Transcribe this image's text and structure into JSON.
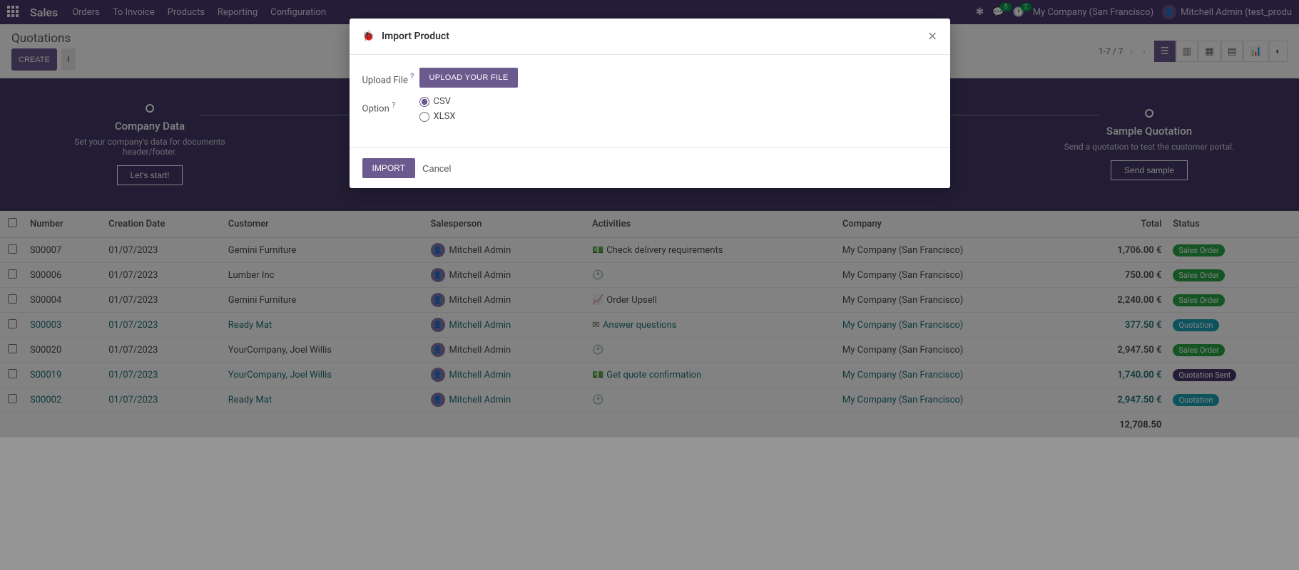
{
  "nav": {
    "brand": "Sales",
    "menu": [
      "Orders",
      "To Invoice",
      "Products",
      "Reporting",
      "Configuration"
    ],
    "chat_badge": "5",
    "clock_badge": "2",
    "company": "My Company (San Francisco)",
    "user": "Mitchell Admin (test_produ"
  },
  "control": {
    "title": "Quotations",
    "create": "CREATE",
    "pager": "1-7 / 7"
  },
  "onboard": {
    "left": {
      "title": "Company Data",
      "desc": "Set your company's data for documents header/footer.",
      "btn": "Let's start!"
    },
    "right": {
      "title": "Sample Quotation",
      "desc": "Send a quotation to test the customer portal.",
      "btn": "Send sample"
    }
  },
  "table": {
    "headers": {
      "number": "Number",
      "date": "Creation Date",
      "customer": "Customer",
      "salesperson": "Salesperson",
      "activities": "Activities",
      "company": "Company",
      "total": "Total",
      "status": "Status"
    },
    "rows": [
      {
        "num": "S00007",
        "date": "01/07/2023",
        "cust": "Gemini Furniture",
        "sp": "Mitchell Admin",
        "act": "Check delivery requirements",
        "act_icon": "money",
        "co": "My Company (San Francisco)",
        "total": "1,706.00 €",
        "status": "Sales Order",
        "sclass": "sb-sales",
        "link": false
      },
      {
        "num": "S00006",
        "date": "01/07/2023",
        "cust": "Lumber Inc",
        "sp": "Mitchell Admin",
        "act": "",
        "act_icon": "clock",
        "co": "My Company (San Francisco)",
        "total": "750.00 €",
        "status": "Sales Order",
        "sclass": "sb-sales",
        "link": false
      },
      {
        "num": "S00004",
        "date": "01/07/2023",
        "cust": "Gemini Furniture",
        "sp": "Mitchell Admin",
        "act": "Order Upsell",
        "act_icon": "line",
        "co": "My Company (San Francisco)",
        "total": "2,240.00 €",
        "status": "Sales Order",
        "sclass": "sb-sales",
        "link": false
      },
      {
        "num": "S00003",
        "date": "01/07/2023",
        "cust": "Ready Mat",
        "sp": "Mitchell Admin",
        "act": "Answer questions",
        "act_icon": "mail",
        "co": "My Company (San Francisco)",
        "total": "377.50 €",
        "status": "Quotation",
        "sclass": "sb-quot",
        "link": true
      },
      {
        "num": "S00020",
        "date": "01/07/2023",
        "cust": "YourCompany, Joel Willis",
        "sp": "Mitchell Admin",
        "act": "",
        "act_icon": "clock",
        "co": "My Company (San Francisco)",
        "total": "2,947.50 €",
        "status": "Sales Order",
        "sclass": "sb-sales",
        "link": false
      },
      {
        "num": "S00019",
        "date": "01/07/2023",
        "cust": "YourCompany, Joel Willis",
        "sp": "Mitchell Admin",
        "act": "Get quote confirmation",
        "act_icon": "money",
        "co": "My Company (San Francisco)",
        "total": "1,740.00 €",
        "status": "Quotation Sent",
        "sclass": "sb-sent",
        "link": true
      },
      {
        "num": "S00002",
        "date": "01/07/2023",
        "cust": "Ready Mat",
        "sp": "Mitchell Admin",
        "act": "",
        "act_icon": "clock",
        "co": "My Company (San Francisco)",
        "total": "2,947.50 €",
        "status": "Quotation",
        "sclass": "sb-quot",
        "link": true
      }
    ],
    "footer_total": "12,708.50"
  },
  "modal": {
    "title": "Import Product",
    "upload_label": "Upload File",
    "upload_btn": "UPLOAD YOUR FILE",
    "option_label": "Option",
    "csv": "CSV",
    "xlsx": "XLSX",
    "import_btn": "Import",
    "cancel_btn": "Cancel"
  }
}
